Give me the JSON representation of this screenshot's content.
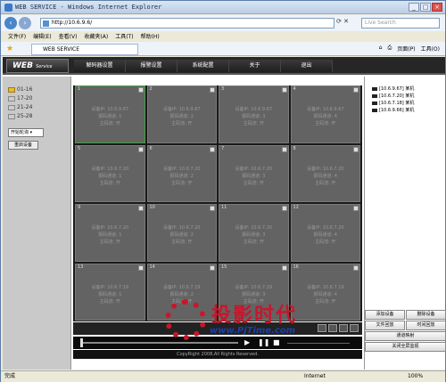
{
  "window": {
    "title": "WEB SERVICE - Windows Internet Explorer"
  },
  "address": {
    "url": "http://10.6.9.6/",
    "search_placeholder": "Live Search"
  },
  "menu": [
    "文件(F)",
    "编辑(E)",
    "查看(V)",
    "收藏夹(A)",
    "工具(T)",
    "帮助(H)"
  ],
  "tab": {
    "label": "WEB SERVICE"
  },
  "toolbar": {
    "page": "页面(P)",
    "tools": "工具(O)"
  },
  "app": {
    "logo": "WEB",
    "logo_sub": "Service",
    "nav": [
      "解码器设置",
      "报警设置",
      "系统配置",
      "关于",
      "退出"
    ]
  },
  "left": {
    "channels": [
      {
        "label": "01-16",
        "active": true
      },
      {
        "label": "17-20",
        "active": false
      },
      {
        "label": "21-24",
        "active": false
      },
      {
        "label": "25-28",
        "active": false
      }
    ],
    "select": "开始轮询",
    "reconnect": "重启设备"
  },
  "cells": [
    {
      "n": "1",
      "ip": "设备IP: 10.6.9.67",
      "ch": "报码通道: 1",
      "st": "主码流: 开"
    },
    {
      "n": "2",
      "ip": "设备IP: 10.6.9.67",
      "ch": "报码通道: 2",
      "st": "主码流: 开"
    },
    {
      "n": "3",
      "ip": "设备IP: 10.6.9.67",
      "ch": "报码通道: 3",
      "st": "主码流: 开"
    },
    {
      "n": "4",
      "ip": "设备IP: 10.6.9.67",
      "ch": "报码通道: 4",
      "st": "主码流: 开"
    },
    {
      "n": "5",
      "ip": "设备IP: 10.6.7.20",
      "ch": "报码通道: 1",
      "st": "主码流: 开"
    },
    {
      "n": "6",
      "ip": "设备IP: 10.6.7.20",
      "ch": "报码通道: 2",
      "st": "主码流: 开"
    },
    {
      "n": "7",
      "ip": "设备IP: 10.6.7.20",
      "ch": "报码通道: 3",
      "st": "主码流: 开"
    },
    {
      "n": "8",
      "ip": "设备IP: 10.6.7.20",
      "ch": "报码通道: 4",
      "st": "主码流: 开"
    },
    {
      "n": "9",
      "ip": "设备IP: 10.6.7.20",
      "ch": "报码通道: 1",
      "st": "主码流: 开"
    },
    {
      "n": "10",
      "ip": "设备IP: 10.6.7.20",
      "ch": "报码通道: 2",
      "st": "主码流: 开"
    },
    {
      "n": "11",
      "ip": "设备IP: 10.6.7.20",
      "ch": "报码通道: 3",
      "st": "主码流: 开"
    },
    {
      "n": "12",
      "ip": "设备IP: 10.6.7.20",
      "ch": "报码通道: 4",
      "st": "主码流: 开"
    },
    {
      "n": "13",
      "ip": "设备IP: 10.6.7.19",
      "ch": "报码通道: 1",
      "st": "主码流: 开"
    },
    {
      "n": "14",
      "ip": "设备IP: 10.6.7.19",
      "ch": "报码通道: 2",
      "st": "主码流: 开"
    },
    {
      "n": "15",
      "ip": "设备IP: 10.6.7.19",
      "ch": "报码通道: 3",
      "st": "主码流: 开"
    },
    {
      "n": "16",
      "ip": "设备IP: 10.6.7.19",
      "ch": "报码通道: 4",
      "st": "主码流: 开"
    }
  ],
  "right": {
    "devices": [
      "[10.6.9.67] 某机",
      "[10.6.7.20] 某机",
      "[10.6.7.18] 某机",
      "[10.6.9.66] 某机"
    ],
    "buttons": {
      "add": "添加设备",
      "del": "删除设备",
      "file": "文件回放",
      "time": "时间回放",
      "map": "通道映射",
      "close": "关闭全屏监视"
    }
  },
  "footer": {
    "copyright": "CopyRight 2008,All Rights Reserved."
  },
  "status": {
    "left": "完成",
    "zone": "Internet",
    "zoom": "100%"
  },
  "watermark": {
    "cn": "投影时代",
    "url": "www.PjTime.com"
  }
}
